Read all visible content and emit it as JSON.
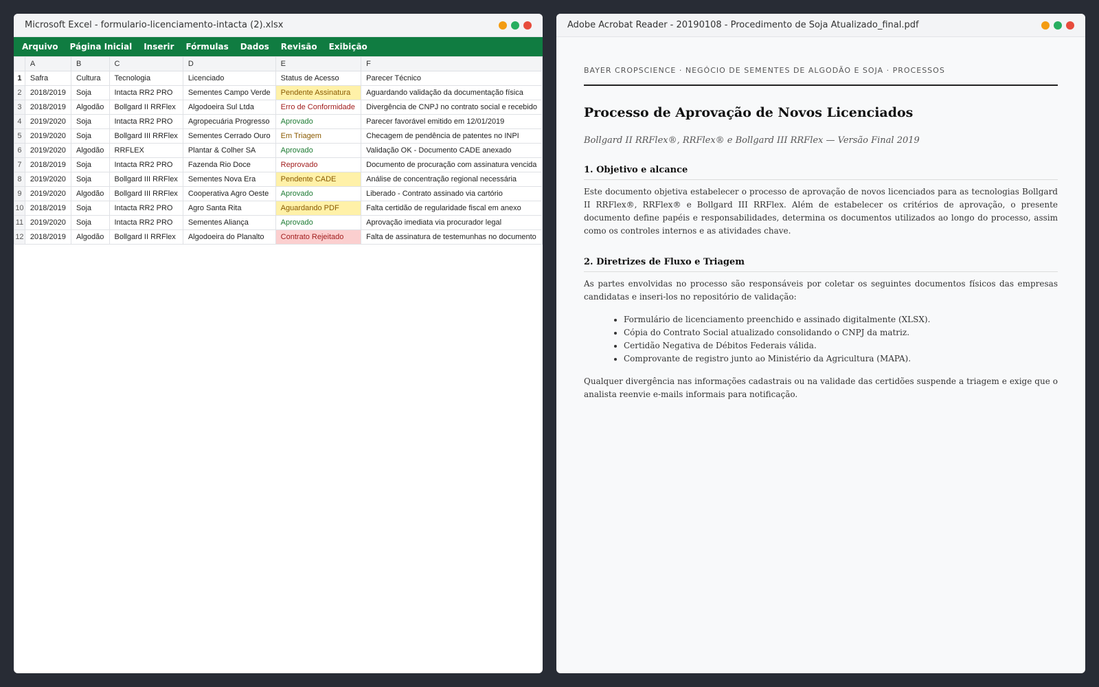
{
  "colors": {
    "desktop_bg": "#282c35",
    "excel_green": "#107c41",
    "dot_orange": "#f39c12",
    "dot_green": "#27ae60",
    "dot_red": "#e74c3c"
  },
  "excel": {
    "title": "Microsoft Excel - formulario-licenciamento-intacta (2).xlsx",
    "menu": [
      "Arquivo",
      "Página Inicial",
      "Inserir",
      "Fórmulas",
      "Dados",
      "Revisão",
      "Exibição"
    ],
    "columns": [
      "A",
      "B",
      "C",
      "D",
      "E",
      "F"
    ],
    "header_row": {
      "num": "1",
      "cells": [
        "Safra",
        "Cultura",
        "Tecnologia",
        "Licenciado",
        "Status de Acesso",
        "Parecer Técnico"
      ]
    },
    "rows": [
      {
        "num": "2",
        "safra": "2018/2019",
        "cultura": "Soja",
        "tecnologia": "Intacta RR2 PRO",
        "licenciado": "Sementes Campo Verde",
        "status": "Pendente Assinatura",
        "status_style": "yellow",
        "parecer": "Aguardando validação da documentação física"
      },
      {
        "num": "3",
        "safra": "2018/2019",
        "cultura": "Algodão",
        "tecnologia": "Bollgard II RRFlex",
        "licenciado": "Algodoeira Sul Ltda",
        "status": "Erro de Conformidade",
        "status_style": "red",
        "parecer": "Divergência de CNPJ no contrato social e recebido"
      },
      {
        "num": "4",
        "safra": "2019/2020",
        "cultura": "Soja",
        "tecnologia": "Intacta RR2 PRO",
        "licenciado": "Agropecuária Progresso",
        "status": "Aprovado",
        "status_style": "green",
        "parecer": "Parecer favorável emitido em 12/01/2019"
      },
      {
        "num": "5",
        "safra": "2019/2020",
        "cultura": "Soja",
        "tecnologia": "Bollgard III RRFlex",
        "licenciado": "Sementes Cerrado Ouro",
        "status": "Em Triagem",
        "status_style": "orange",
        "parecer": "Checagem de pendência de patentes no INPI"
      },
      {
        "num": "6",
        "safra": "2019/2020",
        "cultura": "Algodão",
        "tecnologia": "RRFLEX",
        "licenciado": "Plantar & Colher SA",
        "status": "Aprovado",
        "status_style": "green",
        "parecer": "Validação OK - Documento CADE anexado"
      },
      {
        "num": "7",
        "safra": "2018/2019",
        "cultura": "Soja",
        "tecnologia": "Intacta RR2 PRO",
        "licenciado": "Fazenda Rio Doce",
        "status": "Reprovado",
        "status_style": "red",
        "parecer": "Documento de procuração com assinatura vencida"
      },
      {
        "num": "8",
        "safra": "2019/2020",
        "cultura": "Soja",
        "tecnologia": "Bollgard III RRFlex",
        "licenciado": "Sementes Nova Era",
        "status": "Pendente CADE",
        "status_style": "yellow",
        "parecer": "Análise de concentração regional necessária"
      },
      {
        "num": "9",
        "safra": "2019/2020",
        "cultura": "Algodão",
        "tecnologia": "Bollgard III RRFlex",
        "licenciado": "Cooperativa Agro Oeste",
        "status": "Aprovado",
        "status_style": "green",
        "parecer": "Liberado - Contrato assinado via cartório"
      },
      {
        "num": "10",
        "safra": "2018/2019",
        "cultura": "Soja",
        "tecnologia": "Intacta RR2 PRO",
        "licenciado": "Agro Santa Rita",
        "status": "Aguardando PDF",
        "status_style": "yellow",
        "parecer": "Falta certidão de regularidade fiscal em anexo"
      },
      {
        "num": "11",
        "safra": "2019/2020",
        "cultura": "Soja",
        "tecnologia": "Intacta RR2 PRO",
        "licenciado": "Sementes Aliança",
        "status": "Aprovado",
        "status_style": "green",
        "parecer": "Aprovação imediata via procurador legal"
      },
      {
        "num": "12",
        "safra": "2018/2019",
        "cultura": "Algodão",
        "tecnologia": "Bollgard II RRFlex",
        "licenciado": "Algodoeira do Planalto",
        "status": "Contrato Rejeitado",
        "status_style": "pink",
        "parecer": "Falta de assinatura de testemunhas no documento"
      }
    ]
  },
  "pdf": {
    "title": "Adobe Acrobat Reader - 20190108 - Procedimento de Soja Atualizado_final.pdf",
    "kicker": "BAYER CROPSCIENCE · NEGÓCIO DE SEMENTES DE ALGODÃO E SOJA · PROCESSOS",
    "doc_title": "Processo de Aprovação de Novos Licenciados",
    "subtitle": "Bollgard II RRFlex®, RRFlex® e Bollgard III RRFlex — Versão Final 2019",
    "section1_heading": "1. Objetivo e alcance",
    "section1_text": "Este documento objetiva estabelecer o processo de aprovação de novos licenciados para as tecnologias Bollgard II RRFlex®, RRFlex® e Bollgard III RRFlex. Além de estabelecer os critérios de aprovação, o presente documento define papéis e responsabilidades, determina os documentos utilizados ao longo do processo, assim como os controles internos e as atividades chave.",
    "section2_heading": "2. Diretrizes de Fluxo e Triagem",
    "section2_intro": "As partes envolvidas no processo são responsáveis por coletar os seguintes documentos físicos das empresas candidatas e inseri-los no repositório de validação:",
    "section2_list": [
      "Formulário de licenciamento preenchido e assinado digitalmente (XLSX).",
      "Cópia do Contrato Social atualizado consolidando o CNPJ da matriz.",
      "Certidão Negativa de Débitos Federais válida.",
      "Comprovante de registro junto ao Ministério da Agricultura (MAPA)."
    ],
    "section2_closing": "Qualquer divergência nas informações cadastrais ou na validade das certidões suspende a triagem e exige que o analista reenvie e-mails informais para notificação."
  }
}
